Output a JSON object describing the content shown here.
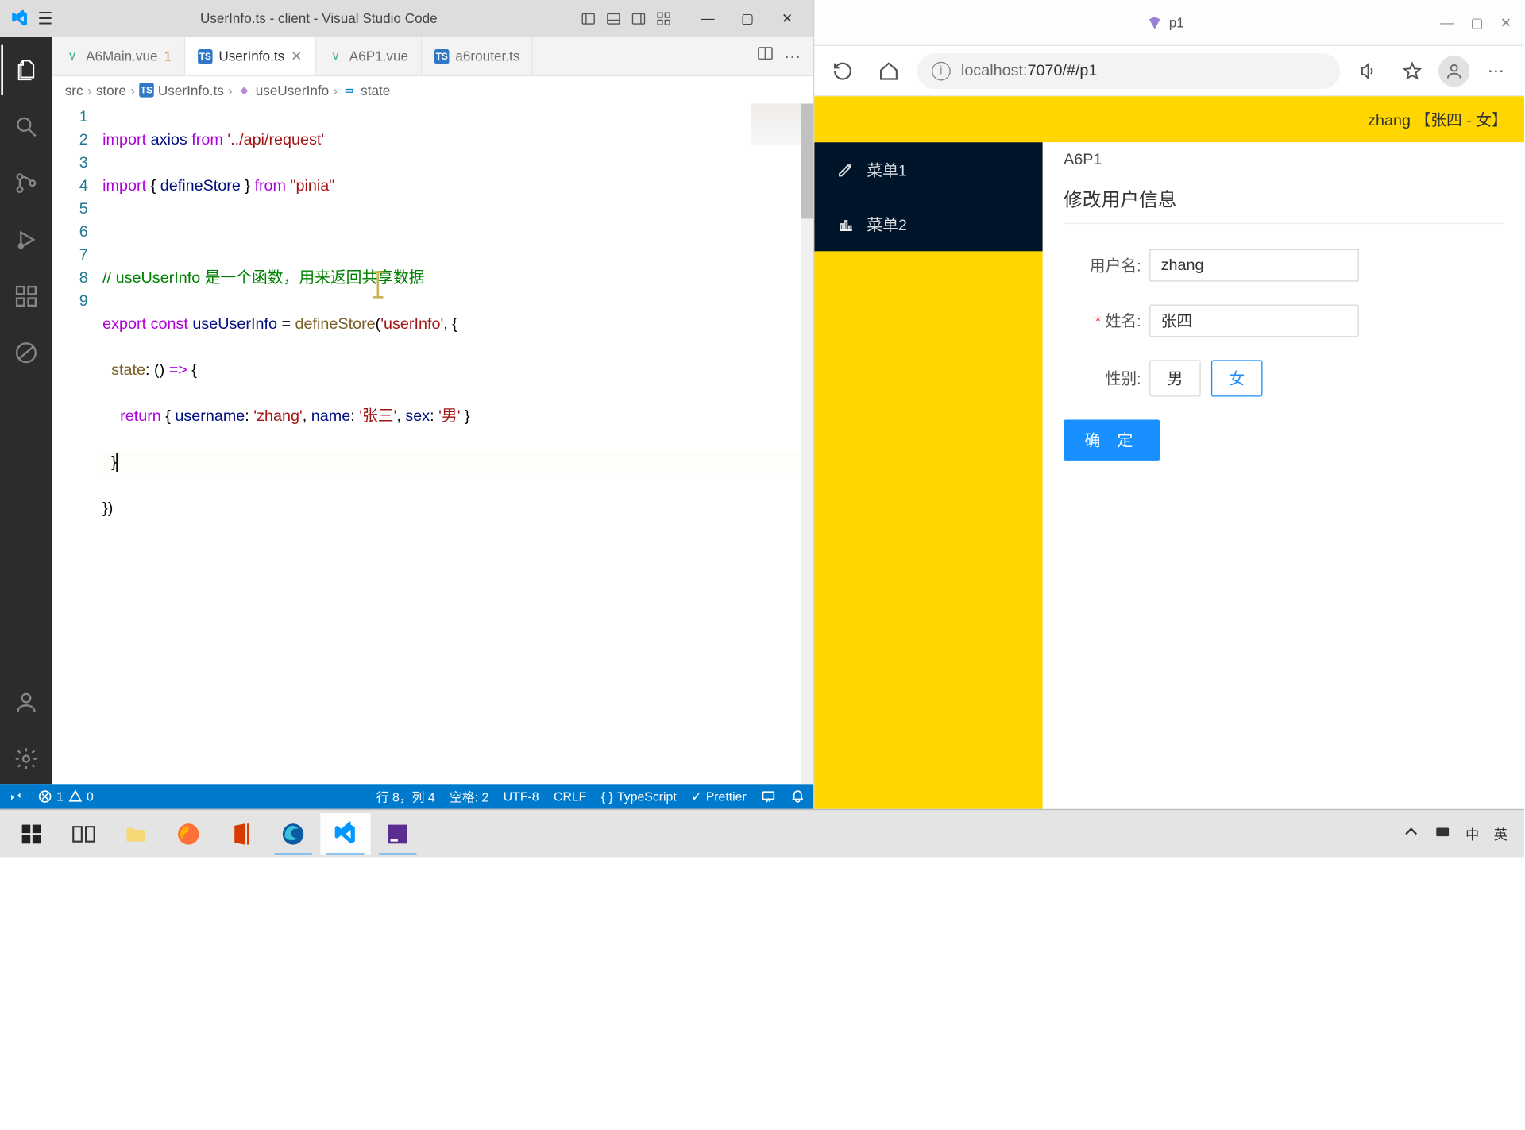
{
  "vscode": {
    "window_title": "UserInfo.ts - client - Visual Studio Code",
    "tabs": [
      {
        "label": "A6Main.vue",
        "modified_badge": "1"
      },
      {
        "label": "UserInfo.ts"
      },
      {
        "label": "A6P1.vue"
      },
      {
        "label": "a6router.ts"
      }
    ],
    "breadcrumb": {
      "p0": "src",
      "p1": "store",
      "p2": "UserInfo.ts",
      "p3": "useUserInfo",
      "p4": "state"
    },
    "status": {
      "remote": "",
      "errors": "1",
      "warnings": "0",
      "cursor": "行 8，列 4",
      "spaces": "空格: 2",
      "encoding": "UTF-8",
      "eol": "CRLF",
      "lang": "TypeScript",
      "formatter": "Prettier"
    }
  },
  "browser": {
    "tab_title": "p1",
    "url_host": "localhost:",
    "url_port_path": "7070/#/p1"
  },
  "webapp": {
    "header_text": "zhang 【张四 - 女】",
    "menu": [
      {
        "label": "菜单1"
      },
      {
        "label": "菜单2"
      }
    ],
    "page_name": "A6P1",
    "form_title": "修改用户信息",
    "labels": {
      "username": "用户名:",
      "name": "姓名:",
      "sex": "性别:"
    },
    "values": {
      "username": "zhang",
      "name": "张四"
    },
    "sex_options": {
      "m": "男",
      "f": "女"
    },
    "submit": "确 定"
  },
  "ime": {
    "lang1": "中",
    "lang2": "英"
  },
  "code": {
    "username": "zhang",
    "name": "张三",
    "sex": "男"
  }
}
